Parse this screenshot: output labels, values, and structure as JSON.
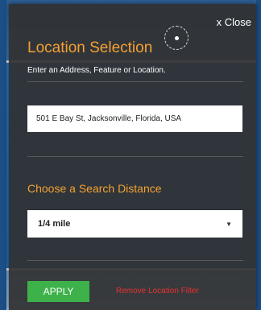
{
  "dialog": {
    "close_label": "x Close",
    "title": "Location Selection",
    "subtitle": "Enter an Address, Feature or Location.",
    "address_value": "501 E Bay St, Jacksonville, Florida, USA",
    "distance_label": "Choose a Search Distance",
    "distance_selected": "1/4 mile",
    "apply_label": "APPLY",
    "remove_label": "Remove Location Filter"
  },
  "icons": {
    "locate": "locate-icon",
    "dropdown": "caret-down-icon"
  },
  "colors": {
    "accent": "#f5a033",
    "apply": "#3db24a",
    "remove": "#e8312f",
    "panel": "#303030"
  }
}
